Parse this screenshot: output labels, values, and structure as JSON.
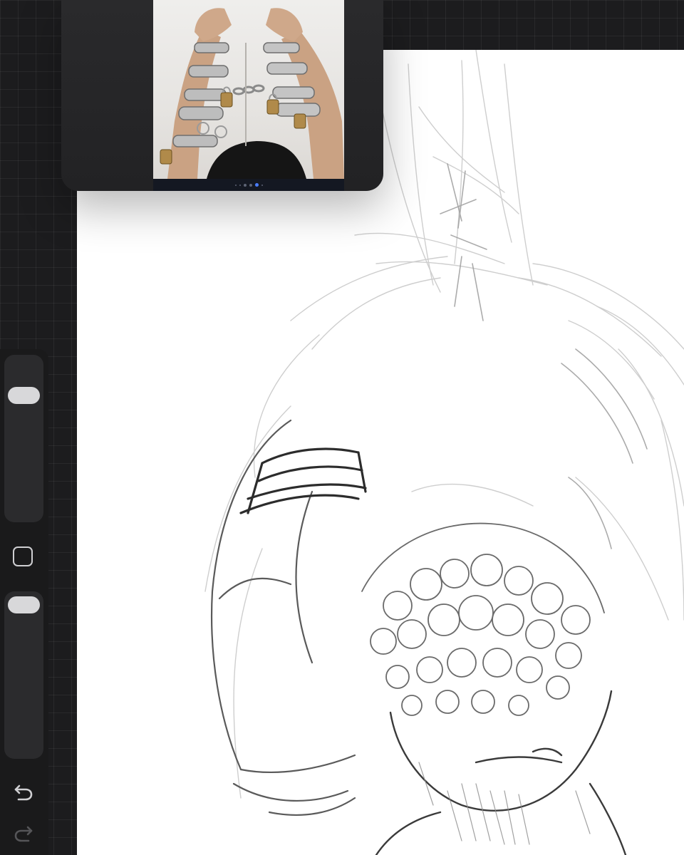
{
  "app": {
    "colors": {
      "background": "#1c1c1e",
      "canvas": "#ffffff",
      "sidebar": "#1a1a1b",
      "slider_thumb": "#d8d8da"
    }
  },
  "reference": {
    "page_count": 6,
    "active_page_index": 3
  },
  "sidebar": {
    "brush_size_slider": {
      "value": 0.2
    },
    "opacity_slider": {
      "value": 0.08
    },
    "modify_button": {
      "icon": "square-icon"
    },
    "undo_button": {
      "icon": "undo-icon",
      "enabled": true
    },
    "redo_button": {
      "icon": "redo-icon",
      "enabled": false
    }
  }
}
